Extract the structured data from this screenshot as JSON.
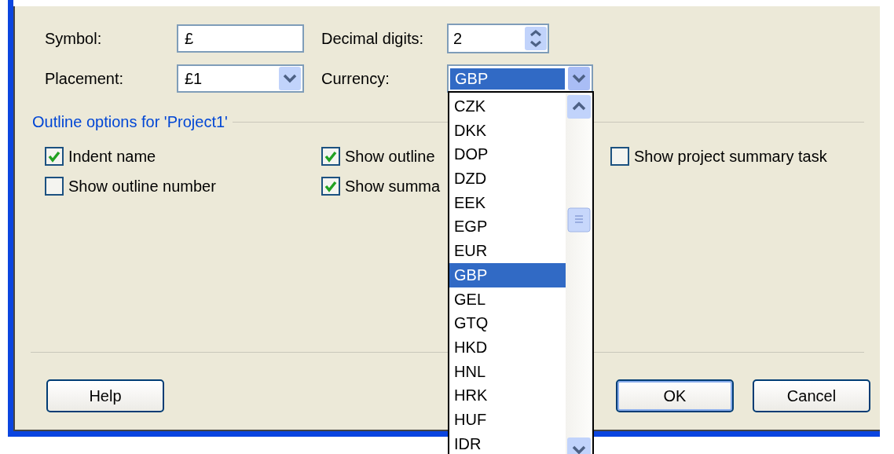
{
  "currency_options": {
    "symbol": {
      "label": "Symbol:",
      "value": "£"
    },
    "decimal_digits": {
      "label": "Decimal digits:",
      "value": "2"
    },
    "placement": {
      "label": "Placement:",
      "value": "£1"
    },
    "currency": {
      "label": "Currency:",
      "value": "GBP",
      "expanded": true,
      "options": [
        {
          "label": "CZK",
          "selected": false
        },
        {
          "label": "DKK",
          "selected": false
        },
        {
          "label": "DOP",
          "selected": false
        },
        {
          "label": "DZD",
          "selected": false
        },
        {
          "label": "EEK",
          "selected": false
        },
        {
          "label": "EGP",
          "selected": false
        },
        {
          "label": "EUR",
          "selected": false
        },
        {
          "label": "GBP",
          "selected": true
        },
        {
          "label": "GEL",
          "selected": false
        },
        {
          "label": "GTQ",
          "selected": false
        },
        {
          "label": "HKD",
          "selected": false
        },
        {
          "label": "HNL",
          "selected": false
        },
        {
          "label": "HRK",
          "selected": false
        },
        {
          "label": "HUF",
          "selected": false
        },
        {
          "label": "IDR",
          "selected": false
        }
      ]
    }
  },
  "outline_options": {
    "title": "Outline options for 'Project1'",
    "checkboxes": [
      {
        "label": "Indent name",
        "checked": true
      },
      {
        "label": "Show outline",
        "checked": true
      },
      {
        "label": "Show project summary task",
        "checked": false
      },
      {
        "label": "Show outline number",
        "checked": false
      },
      {
        "label": "Show summa",
        "checked": true
      }
    ]
  },
  "buttons": [
    {
      "label": "Help",
      "kind": "help"
    },
    {
      "label": "OK",
      "kind": "ok"
    },
    {
      "label": "Cancel",
      "kind": "cancel"
    }
  ]
}
